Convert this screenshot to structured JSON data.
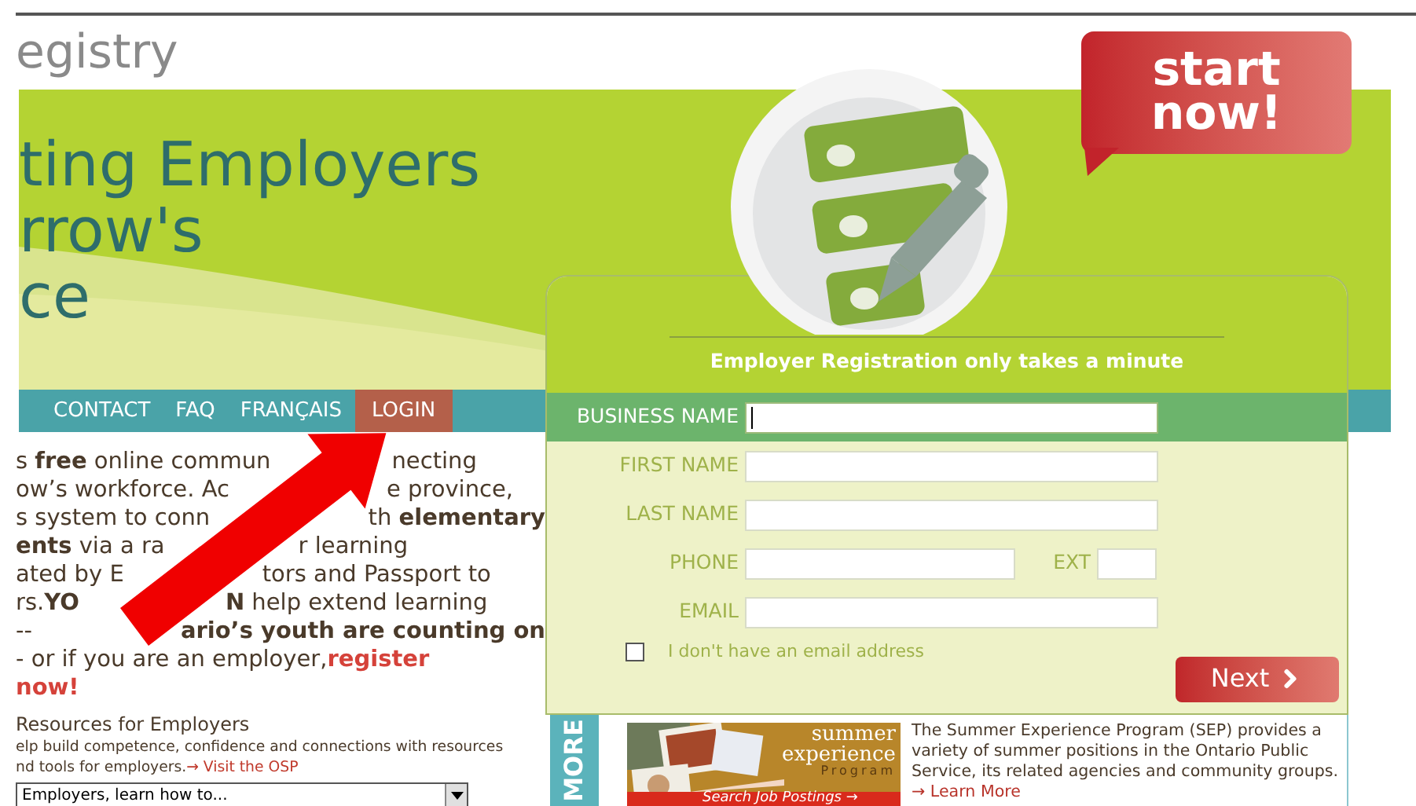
{
  "header": {
    "logo_text": "egistry"
  },
  "banner": {
    "headline": [
      "ting Employers",
      "rrow's",
      "ce"
    ]
  },
  "start_badge": "start now!",
  "nav": [
    {
      "label": "CONTACT",
      "selected": false
    },
    {
      "label": "FAQ",
      "selected": false
    },
    {
      "label": "FRANÇAIS",
      "selected": false
    },
    {
      "label": "LOGIN",
      "selected": true
    }
  ],
  "intro": {
    "lines": [
      {
        "left": "s **free** online commun",
        "right": "necting"
      },
      {
        "left": "ow’s workforce. Ac",
        "right": "e province,"
      },
      {
        "left": "s system to conn",
        "right": "th **elementary**"
      },
      {
        "left": "**ents** via a ra",
        "right": "r learning"
      },
      {
        "left": "ated by E",
        "right": "tors and Passport to"
      },
      {
        "left": "rs.**YO**",
        "right": "**N** help extend learning"
      },
      {
        "left": "--",
        "right": "**ario’s youth are counting on**"
      },
      {
        "left": "- or if you are an employer, ",
        "link": "register"
      },
      {
        "link": "now!"
      }
    ]
  },
  "resources": {
    "title": "Resources for Employers",
    "lines": [
      "elp build competence, confidence and connections with resources",
      "nd tools for employers. "
    ],
    "link": "→ Visit the OSP",
    "select": "Employers, learn how to..."
  },
  "form": {
    "title": "Employer Registration only takes a minute",
    "fields": [
      {
        "kind": "text",
        "label": "BUSINESS NAME",
        "focused": true
      },
      {
        "kind": "text",
        "label": "FIRST NAME",
        "focused": false
      },
      {
        "kind": "text",
        "label": "LAST NAME",
        "focused": false
      },
      {
        "kind": "phone",
        "label": "PHONE",
        "ext_label": "EXT",
        "focused": false
      },
      {
        "kind": "text",
        "label": "EMAIL",
        "focused": false
      }
    ],
    "checkbox": {
      "label": "I don't have an email address",
      "checked": false
    },
    "next_button": "Next"
  },
  "promo": {
    "tab": "MORE",
    "image": {
      "kind": "picture",
      "word_1": "summer",
      "word_2": "experience",
      "word_3": "Program",
      "cta": "Search Job Postings →"
    },
    "text": "The Summer Experience Program (SEP) provides a variety of summer positions in the Ontario Public Service, its related agencies and community groups. ",
    "link": "→ Learn More"
  }
}
